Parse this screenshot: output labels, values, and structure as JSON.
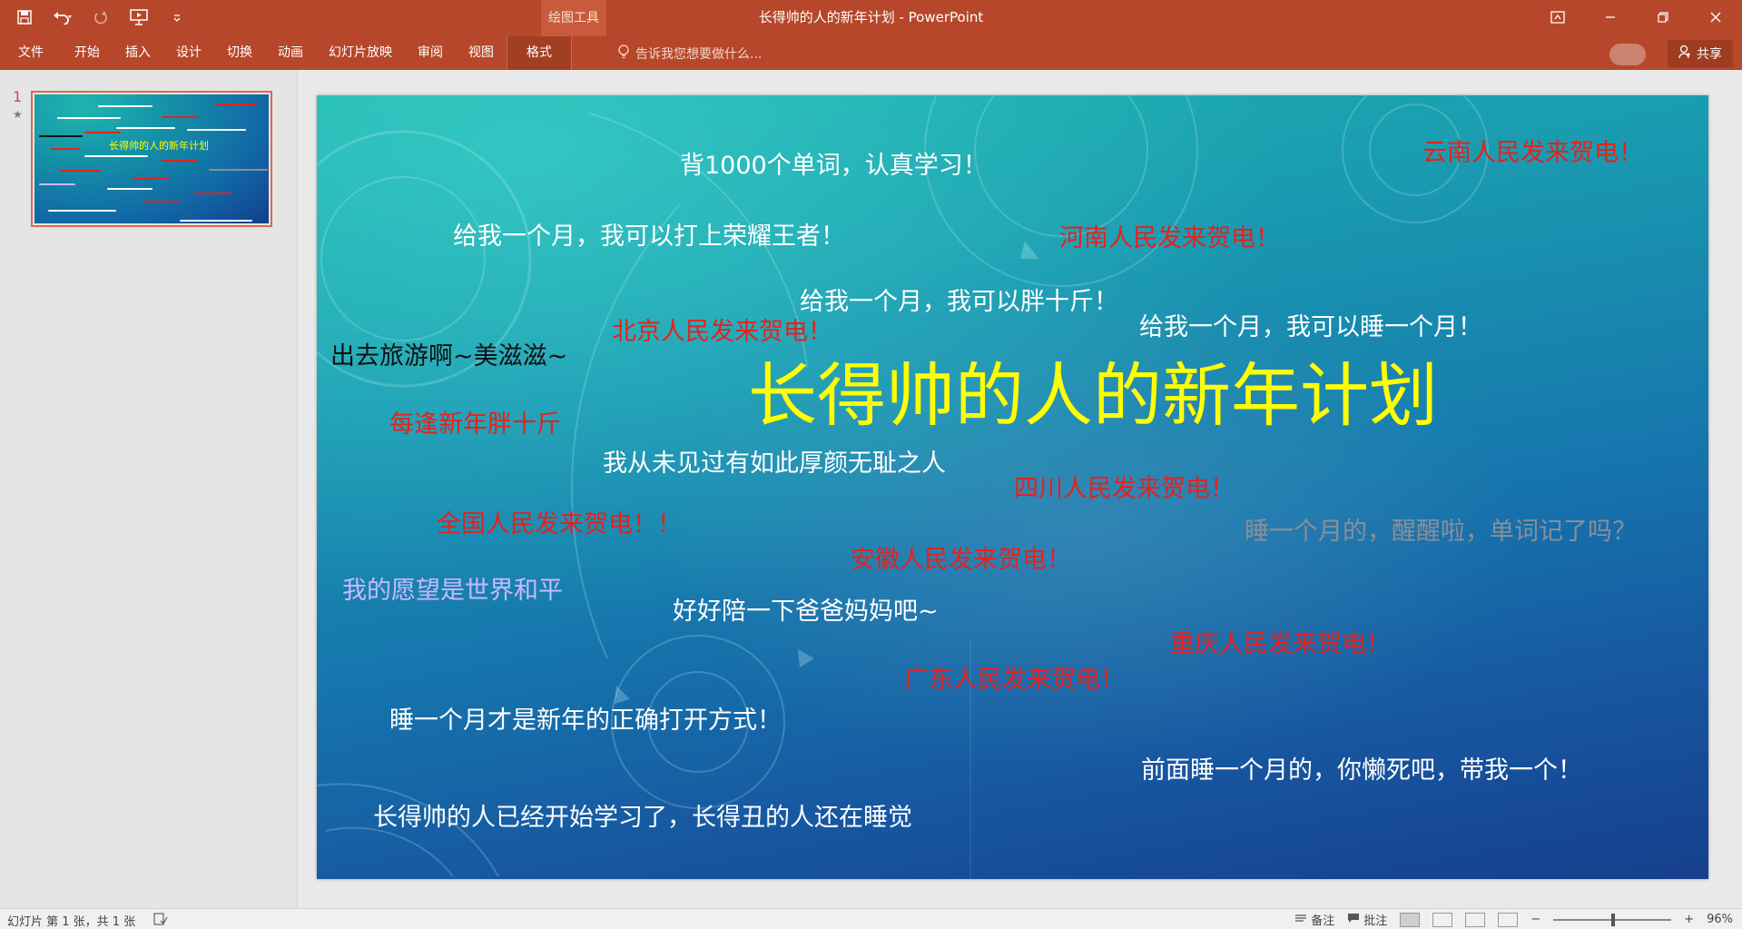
{
  "window": {
    "title": "长得帅的人的新年计划 - PowerPoint",
    "tool_context_label": "绘图工具"
  },
  "ribbon": {
    "file_tab": "文件",
    "tabs": [
      "开始",
      "插入",
      "设计",
      "切换",
      "动画",
      "幻灯片放映",
      "审阅",
      "视图"
    ],
    "active_tab": "格式",
    "tell_me_placeholder": "告诉我您想要做什么...",
    "share_label": "共享"
  },
  "thumbnails": {
    "slide_number": "1",
    "title_text": "长得帅的人的新年计划"
  },
  "slide": {
    "title": "长得帅的人的新年计划",
    "texts": {
      "t01": "背1000个单词，认真学习！",
      "t02": "云南人民发来贺电！",
      "t03": "给我一个月，我可以打上荣耀王者！",
      "t04": "河南人民发来贺电！",
      "t05": "给我一个月，我可以胖十斤！",
      "t06": "给我一个月，我可以睡一个月！",
      "t07": "北京人民发来贺电！",
      "t08": "出去旅游啊~美滋滋~",
      "t09": "每逢新年胖十斤",
      "t10": "我从未见过有如此厚颜无耻之人",
      "t11": "四川人民发来贺电！",
      "t12": "全国人民发来贺电！！",
      "t13": "睡一个月的，醒醒啦，单词记了吗？",
      "t14": "安徽人民发来贺电！",
      "t15": "我的愿望是世界和平",
      "t16": "好好陪一下爸爸妈妈吧~",
      "t17": "重庆人民发来贺电！",
      "t18": "广东人民发来贺电！",
      "t19": "睡一个月才是新年的正确打开方式！",
      "t20": "前面睡一个月的，你懒死吧，带我一个！",
      "t21": "长得帅的人已经开始学习了，长得丑的人还在睡觉"
    }
  },
  "statusbar": {
    "slide_info": "幻灯片 第 1 张，共 1 张",
    "notes_label": "备注",
    "comments_label": "批注",
    "zoom": "96%"
  },
  "colors": {
    "ribbon": "#b7472a",
    "title_yellow": "#ffff00",
    "red_text": "#e8201c"
  }
}
